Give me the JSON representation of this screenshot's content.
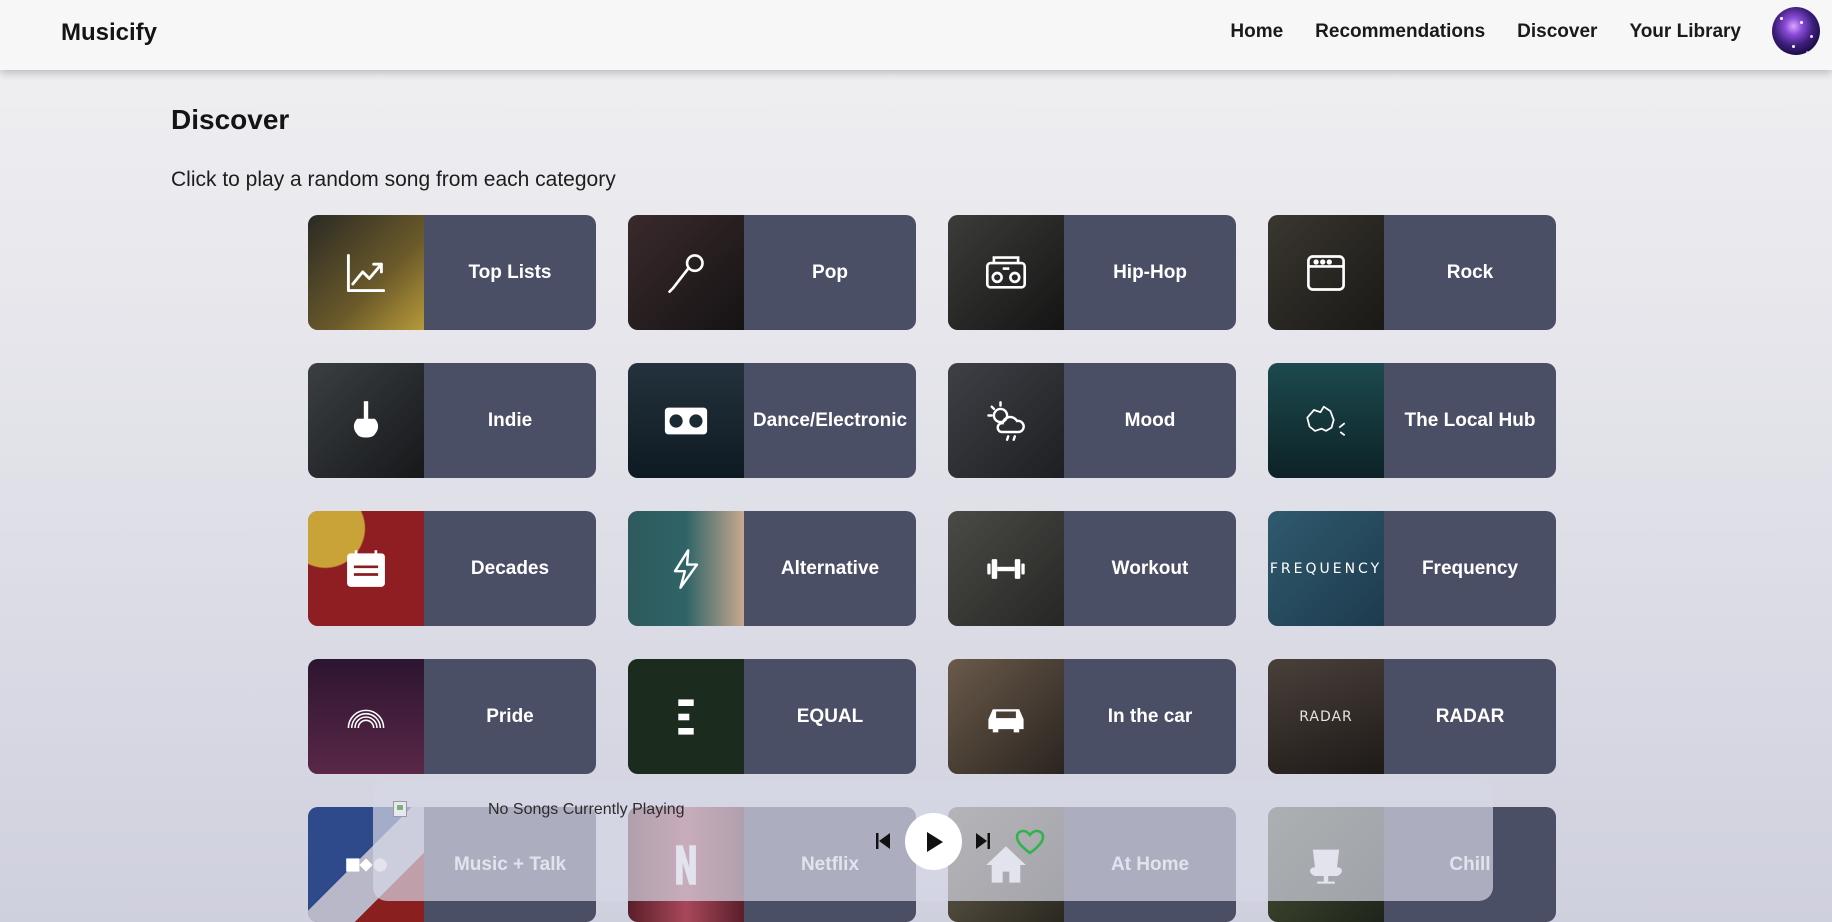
{
  "nav": {
    "brand": "Musicify",
    "links": [
      "Home",
      "Recommendations",
      "Discover",
      "Your Library"
    ]
  },
  "page": {
    "title": "Discover",
    "subtitle": "Click to play a random song from each category"
  },
  "categories": [
    {
      "label": "Top Lists",
      "icon": "chart-line-icon",
      "bg": "#3a3526"
    },
    {
      "label": "Pop",
      "icon": "microphone-icon",
      "bg": "#1d1a1c"
    },
    {
      "label": "Hip-Hop",
      "icon": "boombox-icon",
      "bg": "#1f2021"
    },
    {
      "label": "Rock",
      "icon": "amplifier-icon",
      "bg": "#2b2a26"
    },
    {
      "label": "Indie",
      "icon": "guitar-icon",
      "bg": "#24272a"
    },
    {
      "label": "Dance/Electronic",
      "icon": "turntable-icon",
      "bg": "#1b2a33"
    },
    {
      "label": "Mood",
      "icon": "weather-mood-icon",
      "bg": "#2a2c30"
    },
    {
      "label": "The Local Hub",
      "icon": "map-icon",
      "bg": "#16363a"
    },
    {
      "label": "Decades",
      "icon": "calendar-icon",
      "bg": "#8c1d1f"
    },
    {
      "label": "Alternative",
      "icon": "lightning-icon",
      "bg": "#2e5a5c"
    },
    {
      "label": "Workout",
      "icon": "dumbbell-icon",
      "bg": "#3a3a36"
    },
    {
      "label": "Frequency",
      "icon": "frequency-icon",
      "bg": "#2d4e62",
      "logo_text": "FREQUENCY"
    },
    {
      "label": "Pride",
      "icon": "rainbow-icon",
      "bg": "#4a1f3a"
    },
    {
      "label": "EQUAL",
      "icon": "equal-icon",
      "bg": "#1b2c1e"
    },
    {
      "label": "In the car",
      "icon": "car-icon",
      "bg": "#4a3e34"
    },
    {
      "label": "RADAR",
      "icon": "radar-icon",
      "bg": "#3c3630",
      "logo_text": "RADAR"
    },
    {
      "label": "Music + Talk",
      "icon": "music-talk-icon",
      "bg": "#2e4a8a"
    },
    {
      "label": "Netflix",
      "icon": "netflix-icon",
      "bg": "#6a2a38"
    },
    {
      "label": "At Home",
      "icon": "home-icon",
      "bg": "#4a4538"
    },
    {
      "label": "Chill",
      "icon": "armchair-icon",
      "bg": "#3a4430"
    }
  ],
  "player": {
    "status": "No Songs Currently Playing",
    "heart_color": "#2fb44a"
  }
}
